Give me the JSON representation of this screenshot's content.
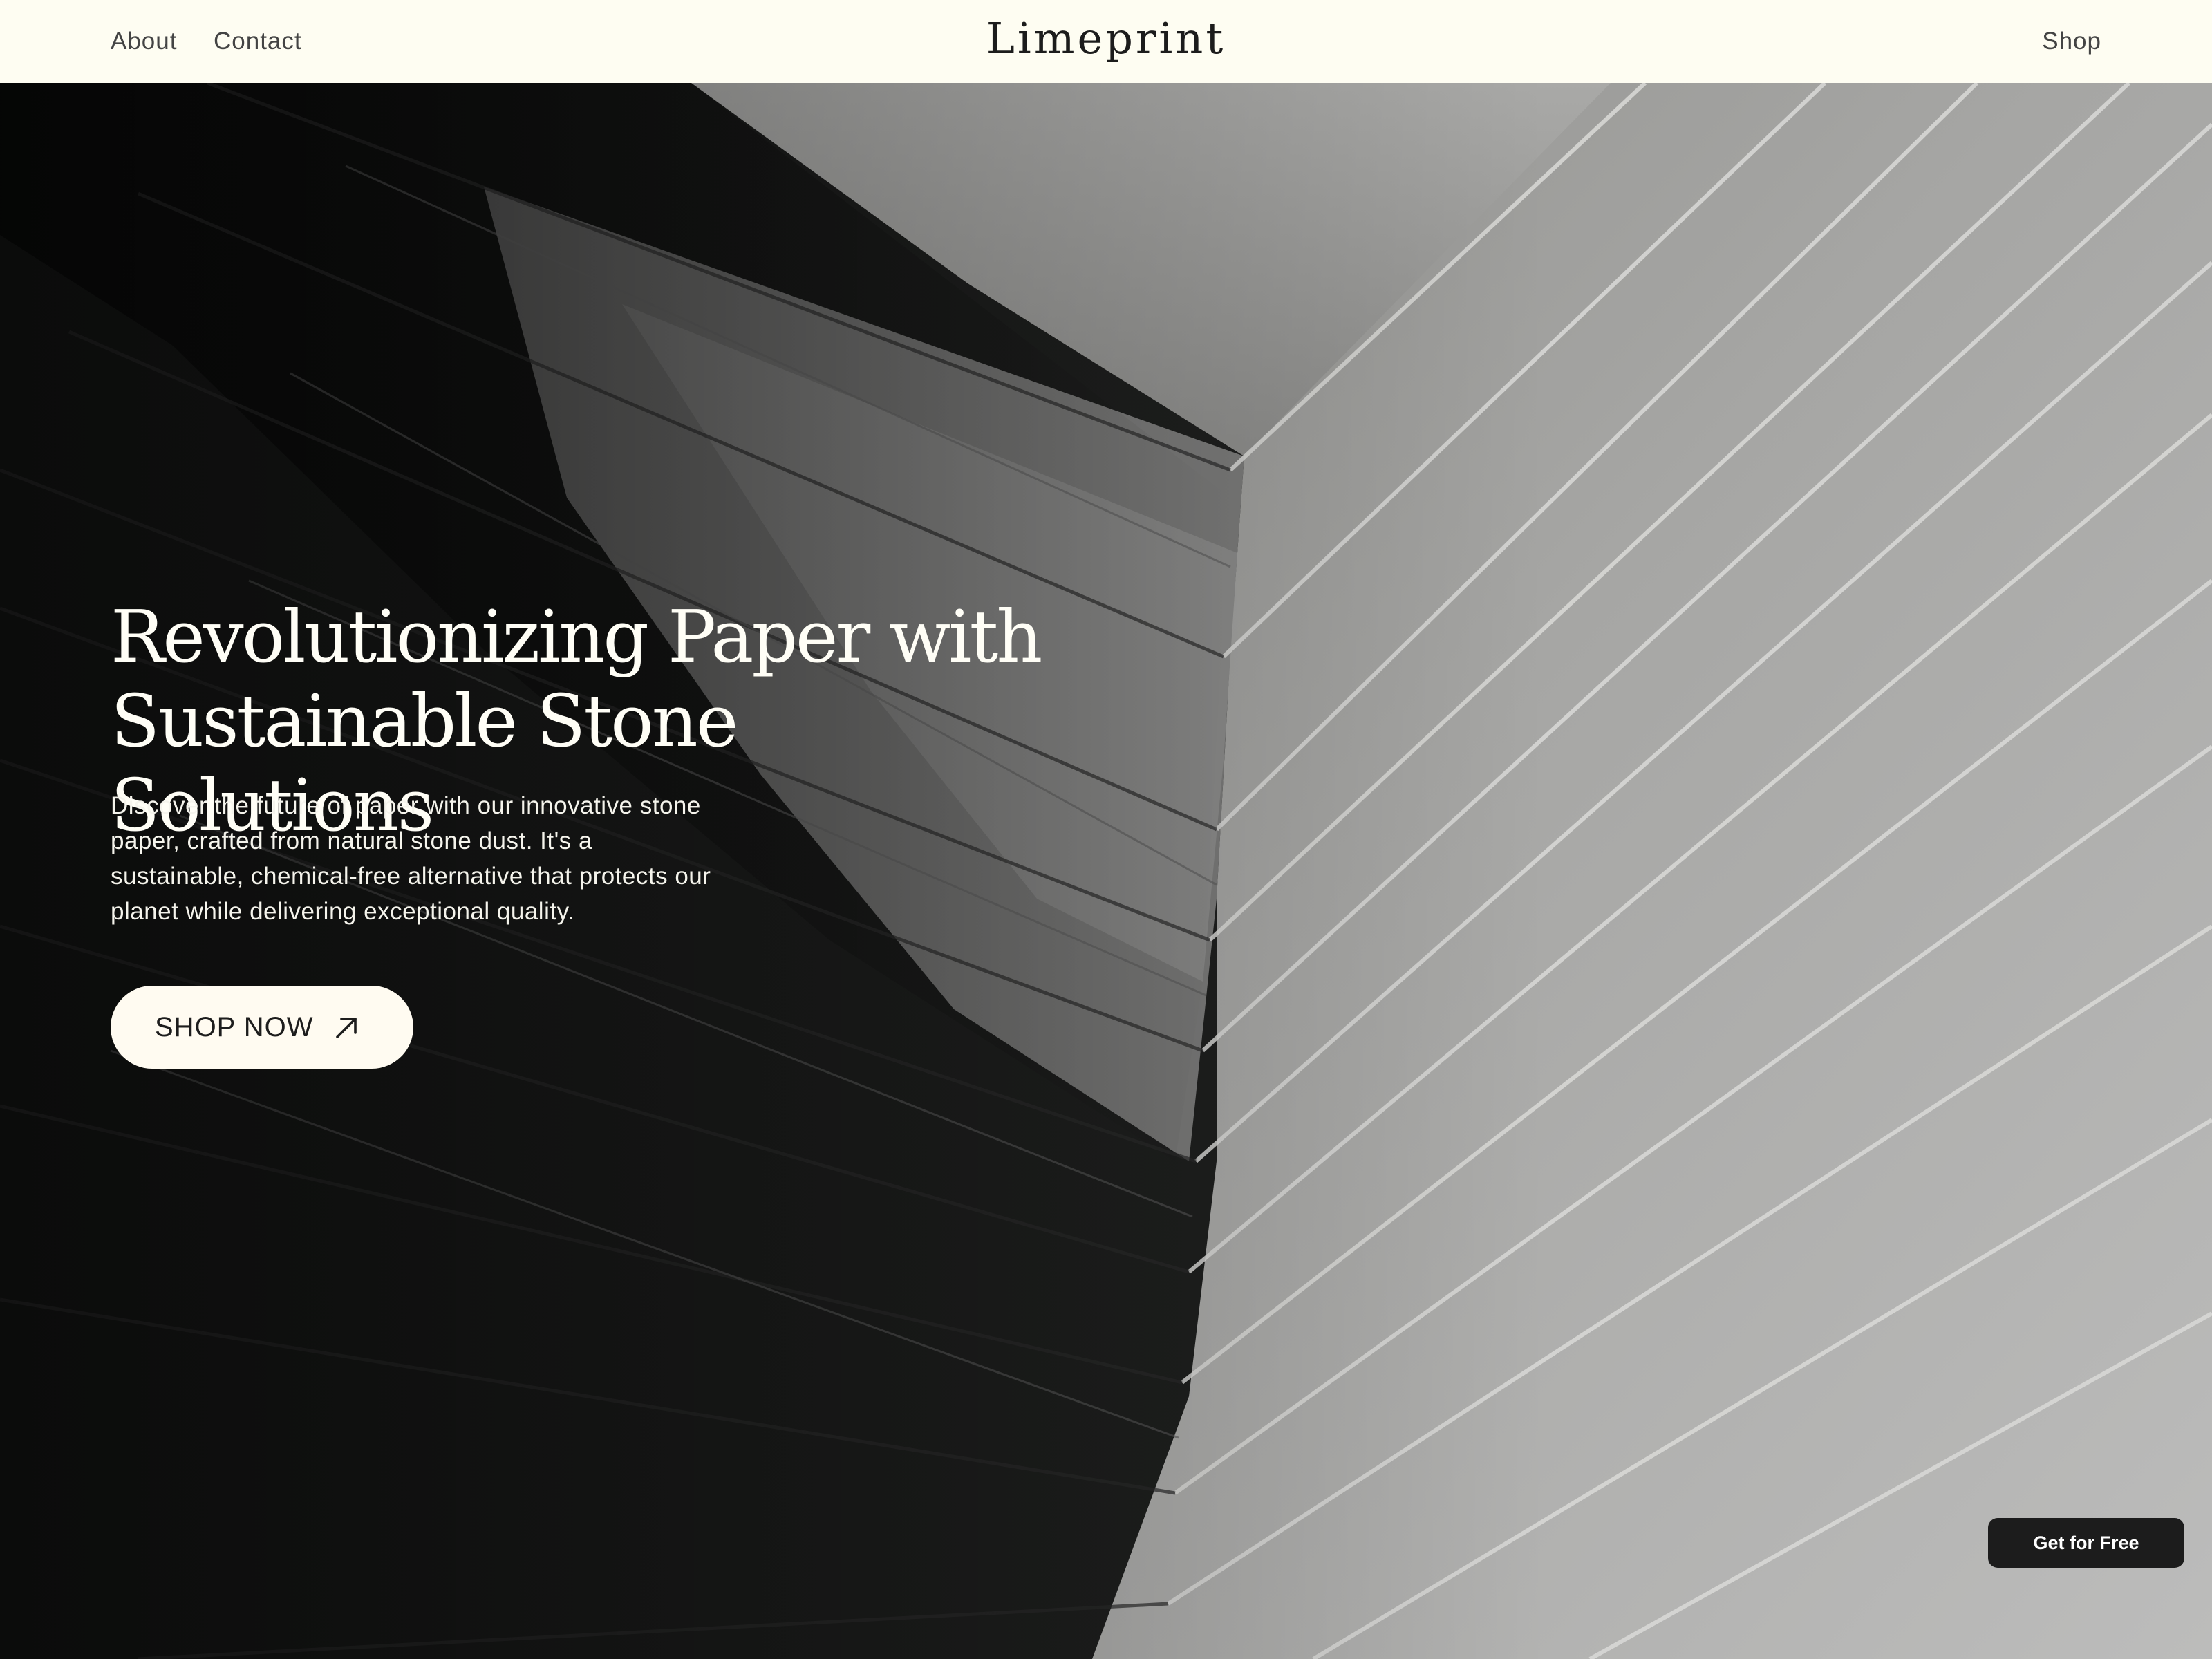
{
  "header": {
    "nav_left": [
      {
        "label": "About"
      },
      {
        "label": "Contact"
      }
    ],
    "logo": "Limeprint",
    "nav_right": {
      "label": "Shop"
    }
  },
  "hero": {
    "title_line1": "Revolutionizing Paper with",
    "title_line2": "Sustainable Stone Solutions",
    "description": "Discover the future of paper with our innovative stone paper, crafted from natural stone dust. It's a sustainable, chemical-free alternative that protects our planet while delivering exceptional quality.",
    "cta_label": "SHOP NOW",
    "cta_icon": "arrow-up-right-icon",
    "background_image": "stacked-stone-paper-sheets-photo"
  },
  "floating_button": {
    "label": "Get for Free"
  },
  "colors": {
    "header_bg": "#fefdf2",
    "hero_text": "#fffef6",
    "cta_bg": "#fffbf1",
    "floating_bg": "#1c1c1c"
  }
}
